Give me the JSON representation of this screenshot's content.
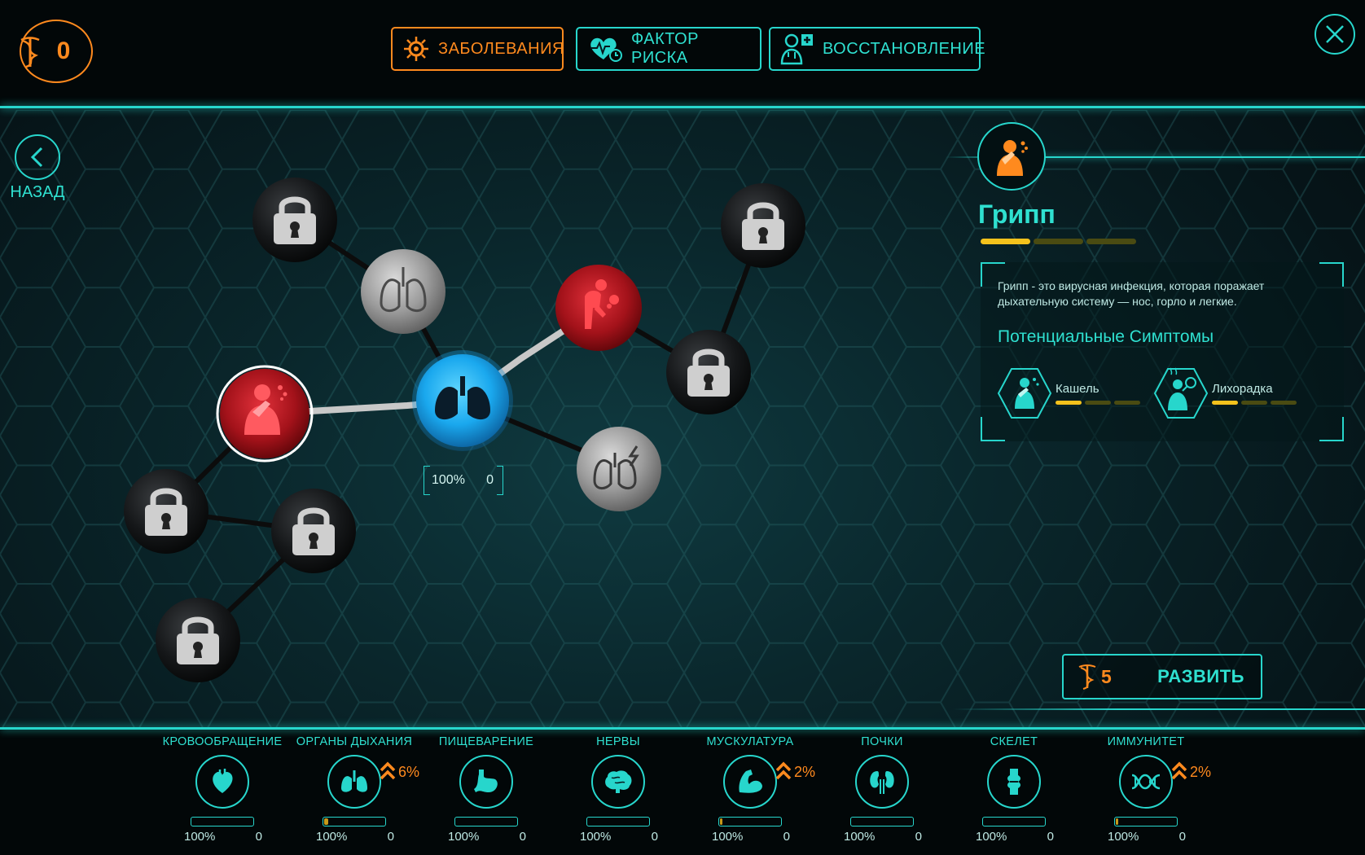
{
  "header": {
    "dna_points": "0",
    "tabs": [
      {
        "label": "ЗАБОЛЕВАНИЯ",
        "icon": "virus-icon",
        "active": true
      },
      {
        "label": "ФАКТОР РИСКА",
        "icon": "heart-pulse-icon",
        "active": false
      },
      {
        "label": "ВОССТАНОВЛЕНИЕ",
        "icon": "doctor-icon",
        "active": false
      }
    ]
  },
  "nav": {
    "back_label": "НАЗАД"
  },
  "tree": {
    "center_node": {
      "icon": "lungs-icon",
      "percent": "100%",
      "count": "0"
    },
    "nodes": [
      {
        "id": "lock-1",
        "state": "locked"
      },
      {
        "id": "lungs-gray",
        "state": "available"
      },
      {
        "id": "bent-person",
        "state": "infected"
      },
      {
        "id": "lock-2",
        "state": "locked"
      },
      {
        "id": "lock-3",
        "state": "locked"
      },
      {
        "id": "coughing-person",
        "state": "selected"
      },
      {
        "id": "lungs-lightning",
        "state": "available"
      },
      {
        "id": "lock-4",
        "state": "locked"
      },
      {
        "id": "lock-5",
        "state": "locked"
      },
      {
        "id": "lock-6",
        "state": "locked"
      }
    ]
  },
  "panel": {
    "disease_name": "Грипп",
    "disease_icon": "coughing-person-icon",
    "level": 1,
    "level_max": 3,
    "description": "Грипп - это вирусная инфекция, которая поражает дыхательную систему — нос, горло и легкие.",
    "symptoms_title": "Потенциальные Симптомы",
    "symptoms": [
      {
        "name": "Кашель",
        "icon": "cough-icon",
        "level": 1,
        "level_max": 3
      },
      {
        "name": "Лихорадка",
        "icon": "fever-icon",
        "level": 1,
        "level_max": 3
      }
    ],
    "evolve": {
      "cost": "5",
      "label": "РАЗВИТЬ"
    }
  },
  "systems": [
    {
      "name": "КРОВООБРАЩЕНИЕ",
      "icon": "heart-icon",
      "percent": "100%",
      "count": "0",
      "boost": "",
      "progress": 0
    },
    {
      "name": "ОРГАНЫ ДЫХАНИЯ",
      "icon": "lungs-icon",
      "percent": "100%",
      "count": "0",
      "boost": "6%",
      "progress": 0.06
    },
    {
      "name": "ПИЩЕВАРЕНИЕ",
      "icon": "stomach-icon",
      "percent": "100%",
      "count": "0",
      "boost": "",
      "progress": 0
    },
    {
      "name": "НЕРВЫ",
      "icon": "brain-icon",
      "percent": "100%",
      "count": "0",
      "boost": "",
      "progress": 0
    },
    {
      "name": "МУСКУЛАТУРА",
      "icon": "muscle-icon",
      "percent": "100%",
      "count": "0",
      "boost": "2%",
      "progress": 0.02
    },
    {
      "name": "ПОЧКИ",
      "icon": "kidneys-icon",
      "percent": "100%",
      "count": "0",
      "boost": "",
      "progress": 0
    },
    {
      "name": "СКЕЛЕТ",
      "icon": "bone-joint-icon",
      "percent": "100%",
      "count": "0",
      "boost": "",
      "progress": 0
    },
    {
      "name": "ИММУНИТЕТ",
      "icon": "dna-icon",
      "percent": "100%",
      "count": "0",
      "boost": "2%",
      "progress": 0.02
    }
  ],
  "colors": {
    "accent": "#27d6cc",
    "orange": "#ff8a1e",
    "level_on": "#f4c21c",
    "level_off": "#4a4b12",
    "infected": "#b0161a",
    "center": "#1aa8ee"
  }
}
